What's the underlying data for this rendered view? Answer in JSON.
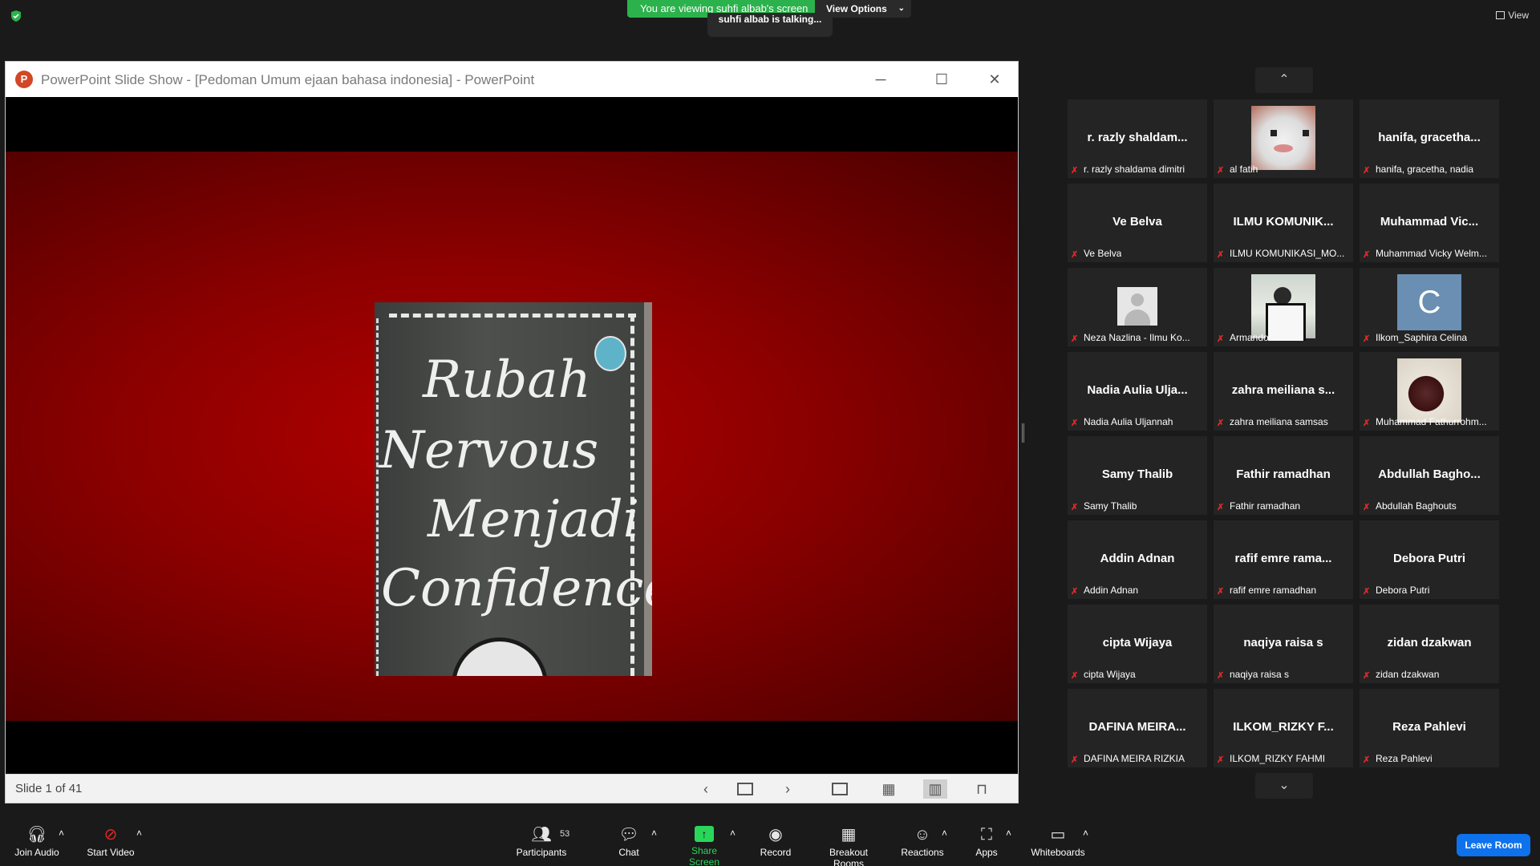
{
  "top": {
    "banner": "You are viewing suhfi albab's screen",
    "view_options": "View Options",
    "talking": "suhfi albab is talking...",
    "view": "View"
  },
  "ppt": {
    "title": "PowerPoint Slide Show - [Pedoman Umum ejaan bahasa indonesia] - PowerPoint",
    "logo_letter": "P",
    "slide_words": [
      "Rubah",
      "Nervous",
      "Menjadi",
      "Confidence"
    ],
    "slide_status": "Slide 1 of 41",
    "accent": "#d24726"
  },
  "gallery": {
    "tiles": [
      {
        "big": "r. razly shaldam...",
        "label": "r. razly shaldama dimitri",
        "pic": ""
      },
      {
        "big": "",
        "label": "al fatih",
        "pic": "cat"
      },
      {
        "big": "hanifa,  gracetha...",
        "label": "hanifa, gracetha, nadia",
        "pic": ""
      },
      {
        "big": "Ve Belva",
        "label": "Ve Belva",
        "pic": ""
      },
      {
        "big": "ILMU  KOMUNIK...",
        "label": "ILMU KOMUNIKASI_MO...",
        "pic": ""
      },
      {
        "big": "Muhammad  Vic...",
        "label": "Muhammad Vicky Welm...",
        "pic": ""
      },
      {
        "big": "",
        "label": "Neza Nazlina - Ilmu Ko...",
        "pic": "avatar"
      },
      {
        "big": "",
        "label": "Armando .",
        "pic": "karate"
      },
      {
        "big": "",
        "label": "Ilkom_Saphira Celina",
        "pic": "letter",
        "letter": "C"
      },
      {
        "big": "Nadia Aulia Ulja...",
        "label": "Nadia Aulia Uljannah",
        "pic": ""
      },
      {
        "big": "zahra meiliana s...",
        "label": "zahra meiliana samsas",
        "pic": ""
      },
      {
        "big": "",
        "label": "Muhammad Fathurrohm...",
        "pic": "face"
      },
      {
        "big": "Samy Thalib",
        "label": "Samy Thalib",
        "pic": ""
      },
      {
        "big": "Fathir ramadhan",
        "label": "Fathir ramadhan",
        "pic": ""
      },
      {
        "big": "Abdullah  Bagho...",
        "label": "Abdullah Baghouts",
        "pic": ""
      },
      {
        "big": "Addin Adnan",
        "label": "Addin Adnan",
        "pic": ""
      },
      {
        "big": "rafif emre rama...",
        "label": "rafif emre ramadhan",
        "pic": ""
      },
      {
        "big": "Debora Putri",
        "label": "Debora Putri",
        "pic": ""
      },
      {
        "big": "cipta Wijaya",
        "label": "cipta Wijaya",
        "pic": ""
      },
      {
        "big": "naqiya raisa s",
        "label": "naqiya raisa s",
        "pic": ""
      },
      {
        "big": "zidan dzakwan",
        "label": "zidan dzakwan",
        "pic": ""
      },
      {
        "big": "DAFINA MEIRA...",
        "label": "DAFINA MEIRA RIZKIA",
        "pic": ""
      },
      {
        "big": "ILKOM_RIZKY F...",
        "label": "ILKOM_RIZKY FAHMI",
        "pic": ""
      },
      {
        "big": "Reza Pahlevi",
        "label": "Reza Pahlevi",
        "pic": ""
      }
    ]
  },
  "toolbar": {
    "join_audio": "Join Audio",
    "start_video": "Start Video",
    "participants": "Participants",
    "participants_count": "53",
    "chat": "Chat",
    "share_screen": "Share Screen",
    "record": "Record",
    "breakout_rooms": "Breakout Rooms",
    "reactions": "Reactions",
    "apps": "Apps",
    "whiteboards": "Whiteboards",
    "leave_room": "Leave Room",
    "share_color": "#2ad65a",
    "leave_color": "#0e72ed"
  }
}
